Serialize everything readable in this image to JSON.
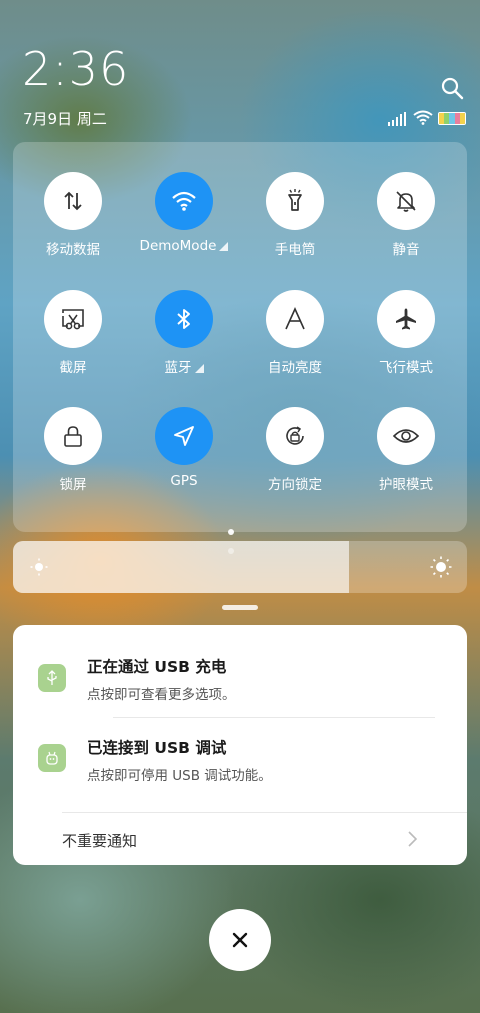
{
  "status": {
    "time": "2:36",
    "date": "7月9日 周二"
  },
  "quick_settings": {
    "tiles": [
      {
        "label": "移动数据",
        "icon": "mobile-data-icon",
        "active": false
      },
      {
        "label": "DemoMode",
        "icon": "wifi-icon",
        "active": true
      },
      {
        "label": "手电筒",
        "icon": "flashlight-icon",
        "active": false
      },
      {
        "label": "静音",
        "icon": "mute-bell-icon",
        "active": false
      },
      {
        "label": "截屏",
        "icon": "screenshot-icon",
        "active": false
      },
      {
        "label": "蓝牙",
        "icon": "bluetooth-icon",
        "active": true
      },
      {
        "label": "自动亮度",
        "icon": "auto-brightness-icon",
        "active": false
      },
      {
        "label": "飞行模式",
        "icon": "airplane-icon",
        "active": false
      },
      {
        "label": "锁屏",
        "icon": "lock-icon",
        "active": false
      },
      {
        "label": "GPS",
        "icon": "gps-icon",
        "active": true
      },
      {
        "label": "方向锁定",
        "icon": "rotation-lock-icon",
        "active": false
      },
      {
        "label": "护眼模式",
        "icon": "eye-icon",
        "active": false
      }
    ],
    "page_count": 2,
    "current_page": 1
  },
  "brightness": {
    "level": 0.74
  },
  "notifications": [
    {
      "title": "正在通过 USB 充电",
      "text": "点按即可查看更多选项。",
      "icon": "usb-charge-icon"
    },
    {
      "title": "已连接到 USB 调试",
      "text": "点按即可停用 USB 调试功能。",
      "icon": "android-debug-icon"
    }
  ],
  "minor_notifications": {
    "label": "不重要通知"
  },
  "colors": {
    "accent": "#1e93f5",
    "notif_icon_bg": "#a9d28f",
    "tile_off": "#ffffff"
  }
}
